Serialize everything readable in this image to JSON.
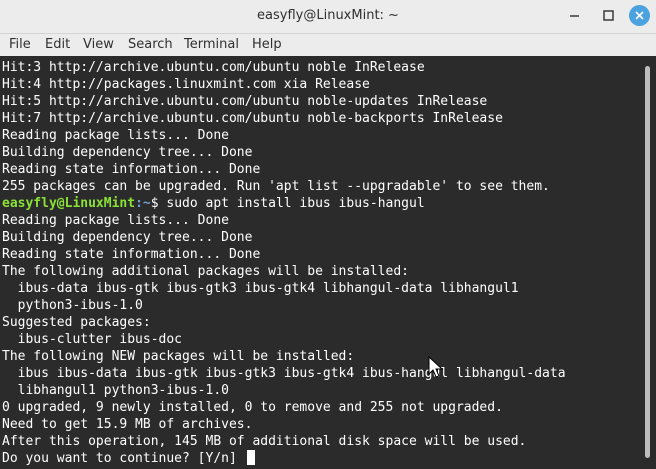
{
  "window": {
    "title": "easyfly@LinuxMint: ~"
  },
  "menu": {
    "file": "File",
    "edit": "Edit",
    "view": "View",
    "search": "Search",
    "terminal": "Terminal",
    "help": "Help"
  },
  "terminal": {
    "lines": [
      "Hit:3 http://archive.ubuntu.com/ubuntu noble InRelease",
      "Hit:4 http://packages.linuxmint.com xia Release",
      "Hit:5 http://archive.ubuntu.com/ubuntu noble-updates InRelease",
      "Hit:7 http://archive.ubuntu.com/ubuntu noble-backports InRelease",
      "Reading package lists... Done",
      "Building dependency tree... Done",
      "Reading state information... Done",
      "255 packages can be upgraded. Run 'apt list --upgradable' to see them."
    ],
    "prompt_user": "easyfly@LinuxMint",
    "prompt_path": ":~",
    "command": "$ sudo apt install ibus ibus-hangul",
    "lines2": [
      "Reading package lists... Done",
      "Building dependency tree... Done",
      "Reading state information... Done",
      "The following additional packages will be installed:",
      "  ibus-data ibus-gtk ibus-gtk3 ibus-gtk4 libhangul-data libhangul1",
      "  python3-ibus-1.0",
      "Suggested packages:",
      "  ibus-clutter ibus-doc",
      "The following NEW packages will be installed:",
      "  ibus ibus-data ibus-gtk ibus-gtk3 ibus-gtk4 ibus-hangul libhangul-data",
      "  libhangul1 python3-ibus-1.0",
      "0 upgraded, 9 newly installed, 0 to remove and 255 not upgraded.",
      "Need to get 15.9 MB of archives.",
      "After this operation, 145 MB of additional disk space will be used."
    ],
    "last_prompt": "Do you want to continue? [Y/n] "
  },
  "colors": {
    "background": "#2b2b2b",
    "text": "#ffffff",
    "prompt_user": "#8ae234",
    "prompt_path": "#729fcf",
    "close_button": "#4aa3df"
  }
}
